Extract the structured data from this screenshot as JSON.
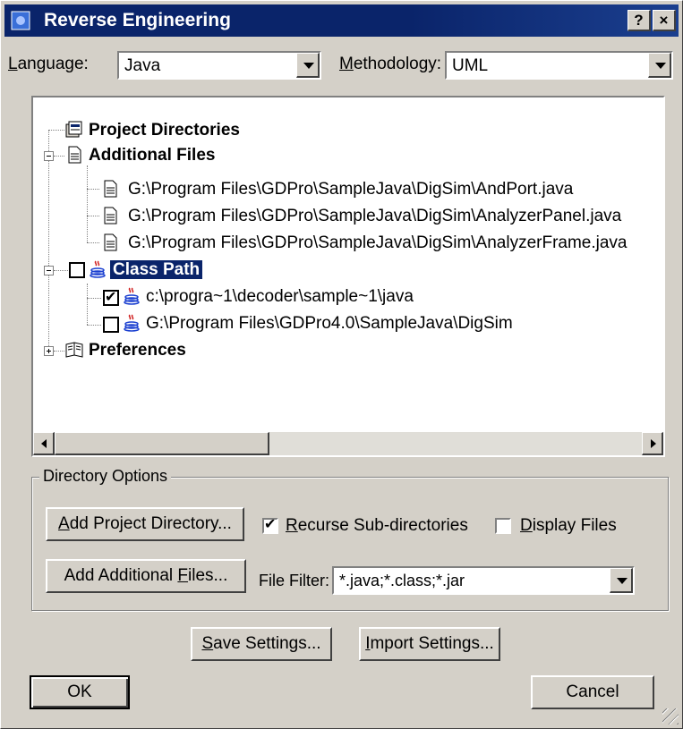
{
  "window": {
    "title": "Reverse Engineering",
    "help_button": "?",
    "close_button": "×"
  },
  "language": {
    "label": "Language:",
    "value": "Java"
  },
  "methodology": {
    "label": "Methodology:",
    "value": "UML"
  },
  "tree": {
    "project_directories": "Project Directories",
    "additional_files": "Additional Files",
    "files": [
      "G:\\Program Files\\GDPro\\SampleJava\\DigSim\\AndPort.java",
      "G:\\Program Files\\GDPro\\SampleJava\\DigSim\\AnalyzerPanel.java",
      "G:\\Program Files\\GDPro\\SampleJava\\DigSim\\AnalyzerFrame.java"
    ],
    "class_path": "Class Path",
    "class_path_items": [
      {
        "label": "c:\\progra~1\\decoder\\sample~1\\java",
        "checked": true
      },
      {
        "label": "G:\\Program Files\\GDPro4.0\\SampleJava\\DigSim",
        "checked": false
      }
    ],
    "preferences": "Preferences"
  },
  "directory_options": {
    "legend": "Directory Options",
    "add_project_directory": "Add Project Directory...",
    "recurse_subdirectories": {
      "label": "Recurse Sub-directories",
      "checked": true
    },
    "display_files": {
      "label": "Display Files",
      "checked": false
    },
    "add_additional_files": "Add Additional Files...",
    "file_filter_label": "File Filter:",
    "file_filter_value": "*.java;*.class;*.jar"
  },
  "buttons": {
    "save_settings": "Save Settings...",
    "import_settings": "Import Settings...",
    "ok": "OK",
    "cancel": "Cancel"
  },
  "colors": {
    "titlebar": "#0a246a",
    "dialog_bg": "#d4d0c8",
    "selection": "#0a246a"
  }
}
